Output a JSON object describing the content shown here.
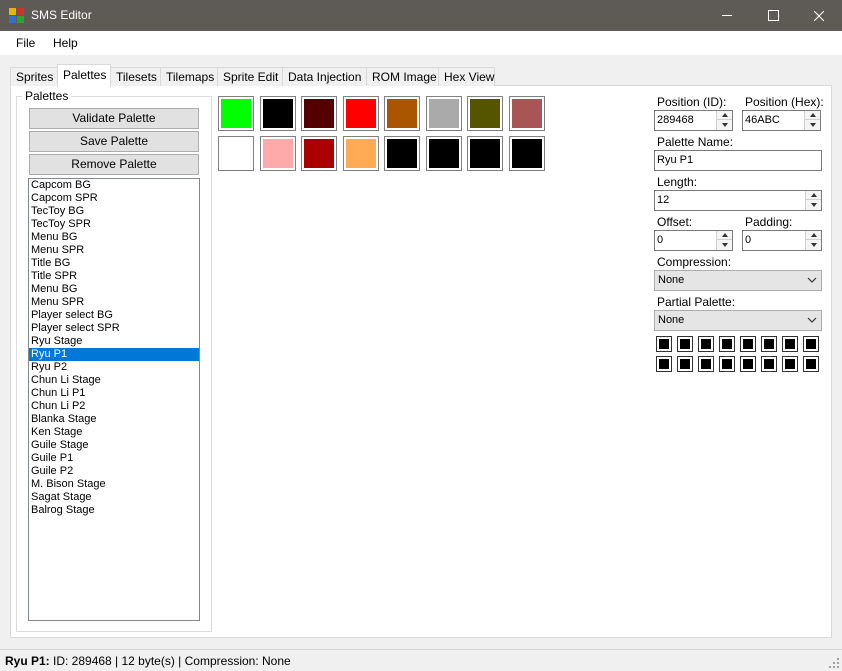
{
  "window": {
    "title": "SMS Editor"
  },
  "menu": {
    "file": "File",
    "help": "Help"
  },
  "tabs": [
    {
      "label": "Sprites"
    },
    {
      "label": "Palettes"
    },
    {
      "label": "Tilesets"
    },
    {
      "label": "Tilemaps"
    },
    {
      "label": "Sprite Edit"
    },
    {
      "label": "Data Injection"
    },
    {
      "label": "ROM Image"
    },
    {
      "label": "Hex View"
    }
  ],
  "active_tab": "Palettes",
  "palettes_group": {
    "title": "Palettes",
    "validate_label": "Validate Palette",
    "save_label": "Save Palette",
    "remove_label": "Remove Palette",
    "items": [
      "Capcom BG",
      "Capcom SPR",
      "TecToy BG",
      "TecToy SPR",
      "Menu BG",
      "Menu SPR",
      "Title BG",
      "Title SPR",
      "Menu BG",
      "Menu SPR",
      "Player select BG",
      "Player select SPR",
      "Ryu Stage",
      "Ryu P1",
      "Ryu P2",
      "Chun Li Stage",
      "Chun Li P1",
      "Chun Li P2",
      "Blanka Stage",
      "Ken Stage",
      "Guile Stage",
      "Guile P1",
      "Guile P2",
      "M. Bison Stage",
      "Sagat Stage",
      "Balrog Stage"
    ],
    "selected_index": 13
  },
  "swatches": [
    "#00ff00",
    "#000000",
    "#550000",
    "#ff0000",
    "#aa5500",
    "#aaaaaa",
    "#555500",
    "#aa5555",
    "#ffffff",
    "#ffaaaa",
    "#aa0000",
    "#ffaa55",
    "#000000",
    "#000000",
    "#000000",
    "#000000"
  ],
  "details": {
    "position_id_label": "Position (ID):",
    "position_id_value": "289468",
    "position_hex_label": "Position (Hex):",
    "position_hex_value": "46ABC",
    "name_label": "Palette Name:",
    "name_value": "Ryu P1",
    "length_label": "Length:",
    "length_value": "12",
    "offset_label": "Offset:",
    "offset_value": "0",
    "padding_label": "Padding:",
    "padding_value": "0",
    "compression_label": "Compression:",
    "compression_value": "None",
    "partial_label": "Partial Palette:",
    "partial_value": "None",
    "partial_checks": 16
  },
  "status": {
    "name": "Ryu P1:",
    "info": "ID: 289468 | 12 byte(s) | Compression: None"
  }
}
